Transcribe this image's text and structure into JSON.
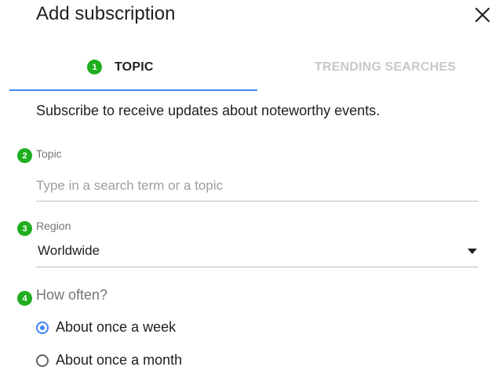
{
  "dialog": {
    "title": "Add subscription"
  },
  "tabs": [
    {
      "label": "TOPIC",
      "badge": "1",
      "active": true
    },
    {
      "label": "TRENDING SEARCHES",
      "active": false
    }
  ],
  "subtitle": "Subscribe to receive updates about noteworthy events.",
  "topic_field": {
    "badge": "2",
    "label": "Topic",
    "value": "",
    "placeholder": "Type in a search term or a topic"
  },
  "region_field": {
    "badge": "3",
    "label": "Region",
    "value": "Worldwide"
  },
  "frequency": {
    "badge": "4",
    "label": "How often?",
    "options": [
      {
        "label": "About once a week",
        "selected": true
      },
      {
        "label": "About once a month",
        "selected": false
      }
    ]
  },
  "colors": {
    "accent": "#4285f4",
    "badge": "#1fae1f"
  },
  "icons": {
    "close": "close-icon",
    "dropdown": "caret-down-icon"
  }
}
